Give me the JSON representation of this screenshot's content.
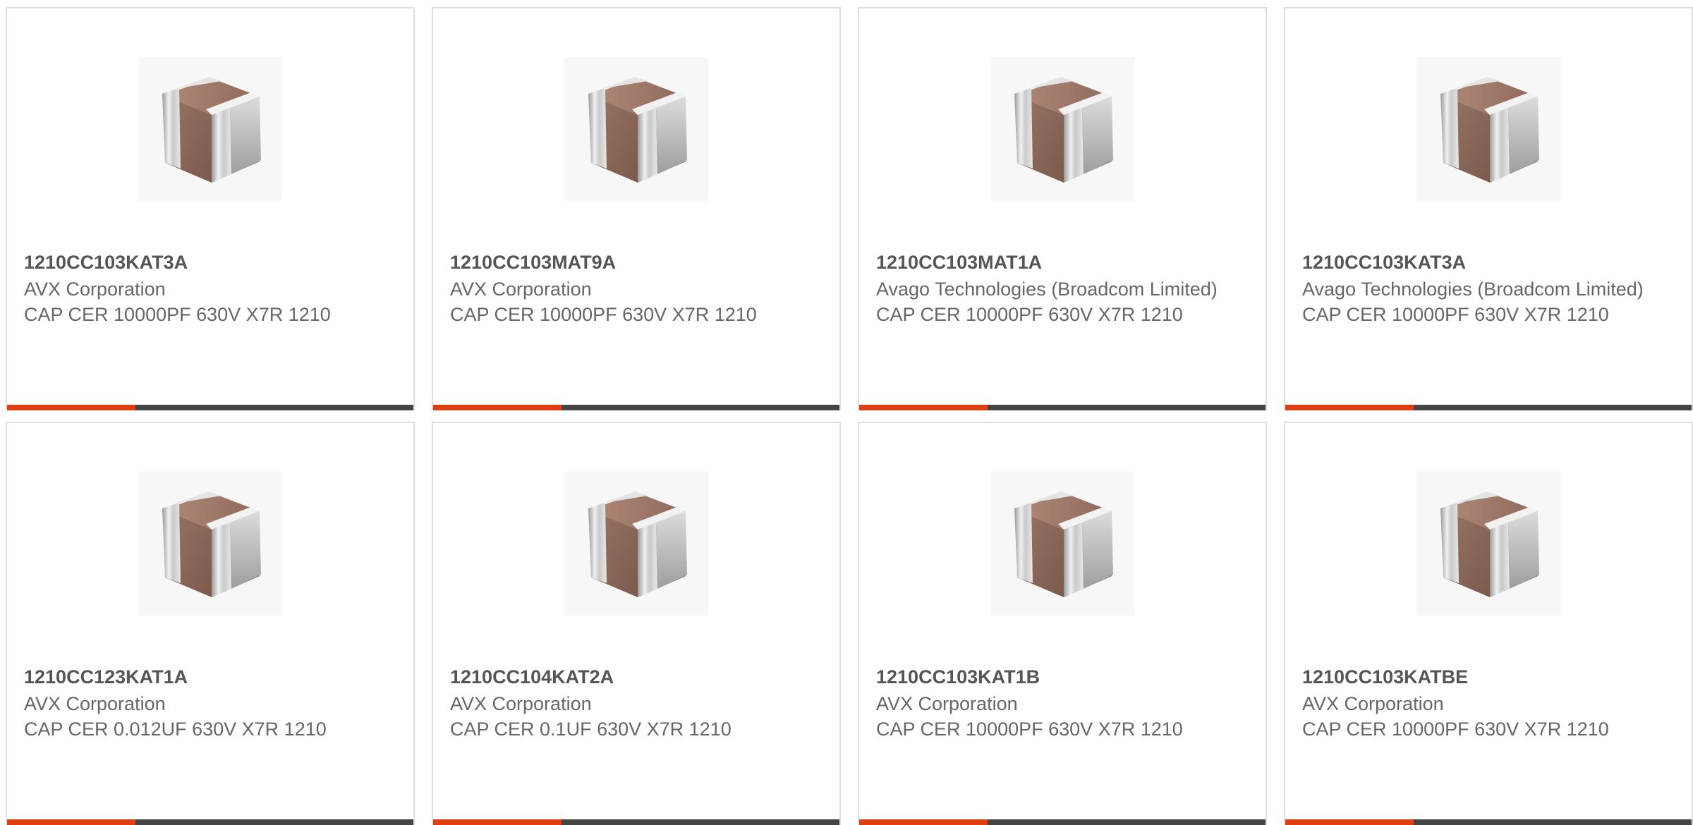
{
  "accent_color": "#e03e10",
  "bar_color": "#444444",
  "product_icon": "ceramic-capacitor-chip",
  "products": [
    {
      "part": "1210CC103KAT3A",
      "maker": "AVX Corporation",
      "desc": "CAP CER 10000PF 630V X7R 1210"
    },
    {
      "part": "1210CC103MAT9A",
      "maker": "AVX Corporation",
      "desc": "CAP CER 10000PF 630V X7R 1210"
    },
    {
      "part": "1210CC103MAT1A",
      "maker": "Avago Technologies (Broadcom Limited)",
      "desc": "CAP CER 10000PF 630V X7R 1210"
    },
    {
      "part": "1210CC103KAT3A",
      "maker": "Avago Technologies (Broadcom Limited)",
      "desc": "CAP CER 10000PF 630V X7R 1210"
    },
    {
      "part": "1210CC123KAT1A",
      "maker": "AVX Corporation",
      "desc": "CAP CER 0.012UF 630V X7R 1210"
    },
    {
      "part": "1210CC104KAT2A",
      "maker": "AVX Corporation",
      "desc": "CAP CER 0.1UF 630V X7R 1210"
    },
    {
      "part": "1210CC103KAT1B",
      "maker": "AVX Corporation",
      "desc": "CAP CER 10000PF 630V X7R 1210"
    },
    {
      "part": "1210CC103KATBE",
      "maker": "AVX Corporation",
      "desc": "CAP CER 10000PF 630V X7R 1210"
    }
  ]
}
